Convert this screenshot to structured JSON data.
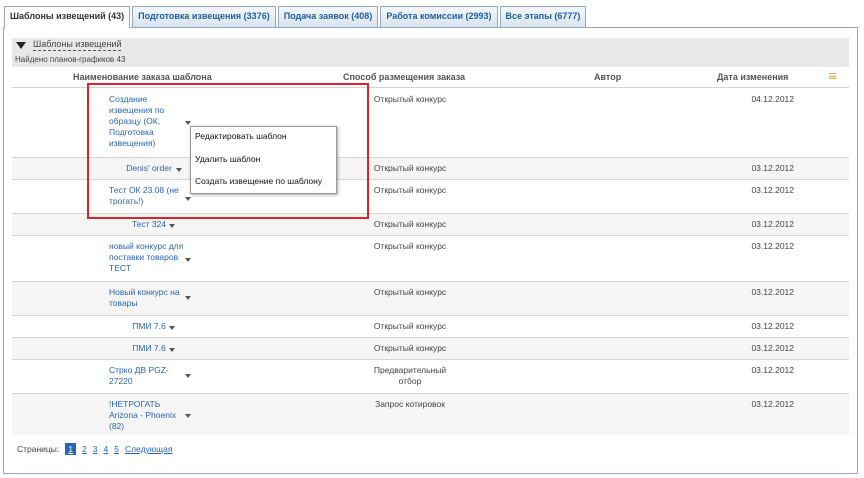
{
  "tabs": [
    {
      "label": "Шаблоны извещений (43)"
    },
    {
      "label": "Подготовка извещения (3376)"
    },
    {
      "label": "Подача заявок (408)"
    },
    {
      "label": "Работа комиссии (2993)"
    },
    {
      "label": "Все этапы (6777)"
    }
  ],
  "group": {
    "title": "Шаблоны извещений",
    "found": "Найдено планов-графиков 43"
  },
  "columns": {
    "name": "Наименование заказа шаблона",
    "method": "Способ размещения заказа",
    "author": "Автор",
    "date": "Дата изменения"
  },
  "rows": [
    {
      "name": "Создание извещения по образцу (ОК, Подготовка извещения)",
      "method": "Открытый конкурс",
      "date": "04.12.2012"
    },
    {
      "name": "Denis' order",
      "method": "Открытый конкурс",
      "date": "03.12.2012"
    },
    {
      "name": "Тест ОК 23.08 (не трогать!)",
      "method": "Открытый конкурс",
      "date": "03.12.2012"
    },
    {
      "name": "Тест 324",
      "method": "Открытый конкурс",
      "date": "03.12.2012"
    },
    {
      "name": "новый конкурс для поставки товаров ТЕСТ",
      "method": "Открытый конкурс",
      "date": "03.12.2012"
    },
    {
      "name": "Новый конкурс на товары",
      "method": "Открытый конкурс",
      "date": "03.12.2012"
    },
    {
      "name": "ПМИ 7.6",
      "method": "Открытый конкурс",
      "date": "03.12.2012"
    },
    {
      "name": "ПМИ 7.6",
      "method": "Открытый конкурс",
      "date": "03.12.2012"
    },
    {
      "name": "Стрко ДВ PGZ-27220",
      "method": "Предварительный отбор",
      "date": "03.12.2012"
    },
    {
      "name": "!НЕТРОГАТЬ Arizona - Phoenix (82)",
      "method": "Запрос котировок",
      "date": "03.12.2012"
    }
  ],
  "context_menu": {
    "edit": "Редактировать шаблон",
    "delete": "Удалить шаблон",
    "create": "Создать извещение по шаблону"
  },
  "pager": {
    "label": "Страницы:",
    "pages": [
      "1",
      "2",
      "3",
      "4",
      "5"
    ],
    "next": "Следующая"
  }
}
